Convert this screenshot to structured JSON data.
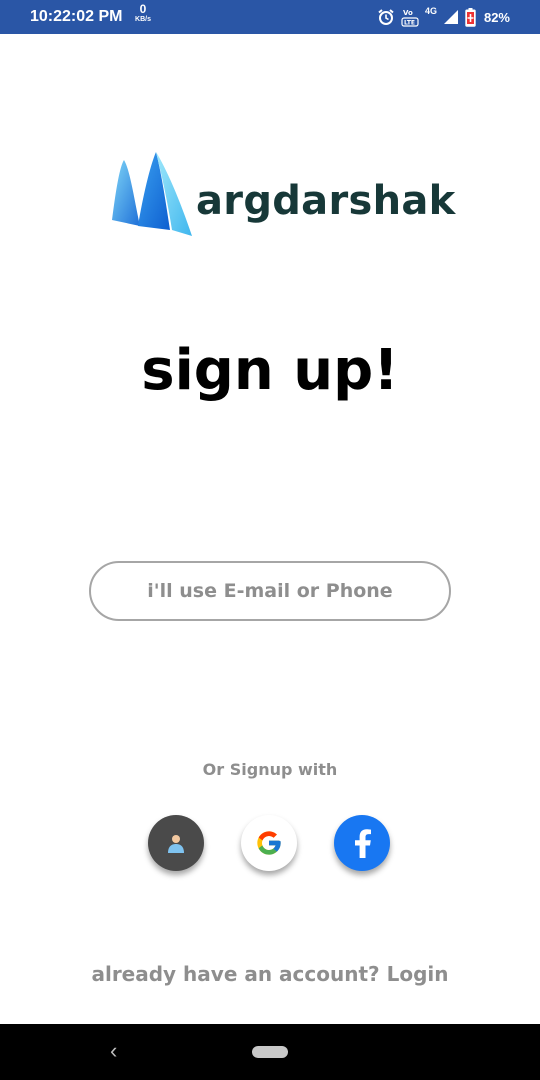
{
  "status_bar": {
    "time": "10:22:02 PM",
    "net_speed_value": "0",
    "net_speed_unit": "KB/s",
    "network_type": "4G",
    "volte_label": "VoLTE",
    "battery": "82%",
    "icons": [
      "alarm-icon",
      "volte-icon",
      "signal-icon",
      "battery-icon"
    ]
  },
  "logo": {
    "text": "argdarshak"
  },
  "heading": "sign up!",
  "email_button": {
    "label": "i'll use E-mail or Phone"
  },
  "or_text": "Or Signup with",
  "social": [
    {
      "name": "guest",
      "icon": "person-icon",
      "color": "#4a4a4a"
    },
    {
      "name": "google",
      "icon": "google-icon",
      "color": "#ffffff"
    },
    {
      "name": "facebook",
      "icon": "facebook-icon",
      "color": "#1877f2"
    }
  ],
  "login": {
    "prompt": "already have an account?",
    "link": "Login"
  },
  "nav": {
    "back_icon": "back-icon",
    "home_icon": "home-pill-icon"
  },
  "colors": {
    "status_bar": "#2a56a6",
    "text_gray": "#8e8e8e",
    "logo_text": "#173838"
  }
}
